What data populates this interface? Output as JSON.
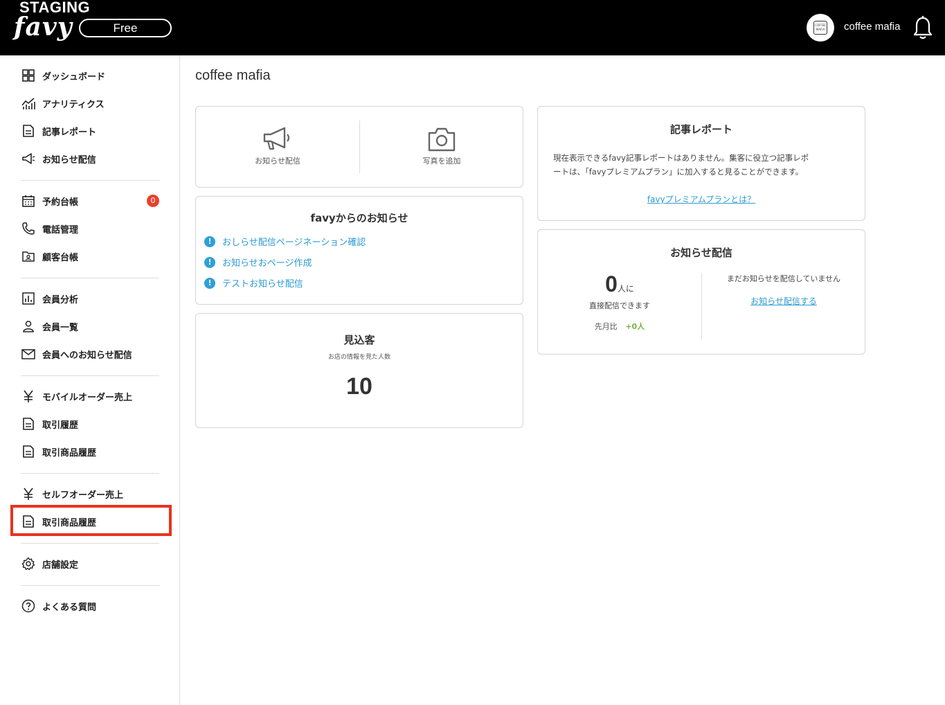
{
  "header": {
    "env_label": "STAGING",
    "logo_text": "favy",
    "plan_label": "Free",
    "shop_name": "coffee mafia",
    "avatar_text": "COFFEE MAFIA"
  },
  "sidebar": {
    "items": [
      {
        "label": "ダッシュボード",
        "icon": "grid-icon"
      },
      {
        "label": "アナリティクス",
        "icon": "chart-line-icon"
      },
      {
        "label": "記事レポート",
        "icon": "document-icon"
      },
      {
        "label": "お知らせ配信",
        "icon": "megaphone-icon"
      },
      {
        "label": "予約台帳",
        "icon": "calendar-icon"
      },
      {
        "label": "電話管理",
        "icon": "phone-icon"
      },
      {
        "label": "顧客台帳",
        "icon": "contact-folder-icon"
      },
      {
        "label": "会員分析",
        "icon": "bar-chart-icon"
      },
      {
        "label": "会員一覧",
        "icon": "user-icon"
      },
      {
        "label": "会員へのお知らせ配信",
        "icon": "mail-icon"
      },
      {
        "label": "モバイルオーダー売上",
        "icon": "yen-icon"
      },
      {
        "label": "取引履歴",
        "icon": "document-icon"
      },
      {
        "label": "取引商品履歴",
        "icon": "document-icon"
      },
      {
        "label": "セルフオーダー売上",
        "icon": "yen-icon"
      },
      {
        "label": "取引商品履歴",
        "icon": "document-icon"
      },
      {
        "label": "店舗設定",
        "icon": "gear-icon"
      },
      {
        "label": "よくある質問",
        "icon": "question-icon"
      }
    ],
    "reservation_badge": "0"
  },
  "main": {
    "title": "coffee mafia",
    "actions": {
      "notice_label": "お知らせ配信",
      "photo_label": "写真を追加"
    },
    "favy_notices": {
      "title": "favyからのお知らせ",
      "items": [
        "おしらせ配信ページネーション確認",
        "お知らせおページ作成",
        "テストお知らせ配信"
      ]
    },
    "prospects": {
      "title": "見込客",
      "subtitle": "お店の情報を見た人数",
      "value": "10"
    },
    "article_report": {
      "title": "記事レポート",
      "body_line1": "現在表示できるfavy記事レポートはありません。集客に役立つ記事レポ",
      "body_line2": "ートは、「favyプレミアムプラン」に加入すると見ることができます。",
      "link": "favyプレミアムプランとは？"
    },
    "notice_delivery": {
      "title": "お知らせ配信",
      "count": "0",
      "count_unit": "人に",
      "count_caption": "直接配信できます",
      "compare_label": "先月比",
      "compare_value": "+0人",
      "empty_text": "まだお知らせを配信していません",
      "cta_link": "お知らせ配信する"
    }
  },
  "colors": {
    "topbar": "#000000",
    "accent_link": "#2b9bd3",
    "badge_red": "#e9412b",
    "highlight_red": "#e8321e",
    "positive_green": "#7cb342"
  }
}
